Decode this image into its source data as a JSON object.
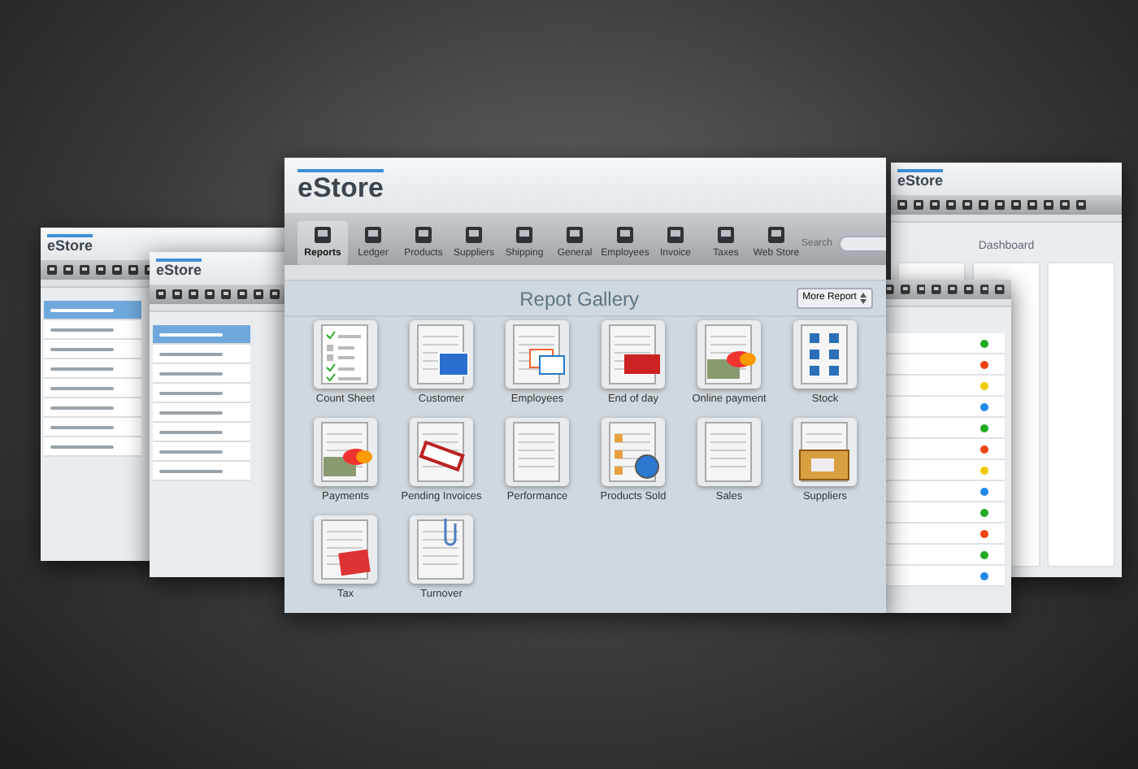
{
  "background_windows": [
    {
      "kind": "list",
      "logo": "eStore",
      "rows": [
        {
          "selected": true
        },
        {
          "selected": false
        },
        {
          "selected": false
        },
        {
          "selected": false
        },
        {
          "selected": false
        },
        {
          "selected": false
        },
        {
          "selected": false
        },
        {
          "selected": false
        }
      ]
    },
    {
      "kind": "list",
      "logo": "eStore",
      "rows": [
        {
          "selected": true
        },
        {
          "selected": false
        },
        {
          "selected": false
        },
        {
          "selected": false
        },
        {
          "selected": false
        },
        {
          "selected": false
        },
        {
          "selected": false
        },
        {
          "selected": false
        }
      ]
    },
    {
      "kind": "dashboard",
      "logo": "eStore",
      "title": "Dashboard"
    },
    {
      "kind": "table",
      "status_dots": [
        {
          "color": "#22aa22"
        },
        {
          "color": "#ee4411"
        },
        {
          "color": "#eecc00"
        },
        {
          "color": "#2288ee"
        },
        {
          "color": "#22aa22"
        },
        {
          "color": "#ee4411"
        },
        {
          "color": "#eecc00"
        },
        {
          "color": "#2288ee"
        },
        {
          "color": "#22aa22"
        },
        {
          "color": "#ee4411"
        },
        {
          "color": "#22aa22"
        },
        {
          "color": "#2288ee"
        }
      ]
    }
  ],
  "main_window": {
    "logo": "eStore",
    "search": {
      "label": "Search"
    },
    "toolbar": [
      {
        "label": "Reports",
        "selected": true
      },
      {
        "label": "Ledger",
        "selected": false
      },
      {
        "label": "Products",
        "selected": false
      },
      {
        "label": "Suppliers",
        "selected": false
      },
      {
        "label": "Shipping",
        "selected": false
      },
      {
        "label": "General",
        "selected": false
      },
      {
        "label": "Employees",
        "selected": false
      },
      {
        "label": "Invoice",
        "selected": false
      },
      {
        "label": "Taxes",
        "selected": false
      },
      {
        "label": "Web Store",
        "selected": false
      }
    ],
    "gallery": {
      "title": "Repot Gallery",
      "more_button": "More Report",
      "items": [
        {
          "label": "Count Sheet",
          "kind": "checklist"
        },
        {
          "label": "Customer",
          "kind": "photo"
        },
        {
          "label": "Employees",
          "kind": "badge"
        },
        {
          "label": "End of day",
          "kind": "closed"
        },
        {
          "label": "Online payment",
          "kind": "card"
        },
        {
          "label": "Stock",
          "kind": "stock"
        },
        {
          "label": "Payments",
          "kind": "card"
        },
        {
          "label": "Pending Invoices",
          "kind": "stamp"
        },
        {
          "label": "Performance",
          "kind": "plain"
        },
        {
          "label": "Products Sold",
          "kind": "clock"
        },
        {
          "label": "Sales",
          "kind": "plain"
        },
        {
          "label": "Suppliers",
          "kind": "truck"
        },
        {
          "label": "Tax",
          "kind": "percent"
        },
        {
          "label": "Turnover",
          "kind": "clip"
        }
      ]
    }
  }
}
